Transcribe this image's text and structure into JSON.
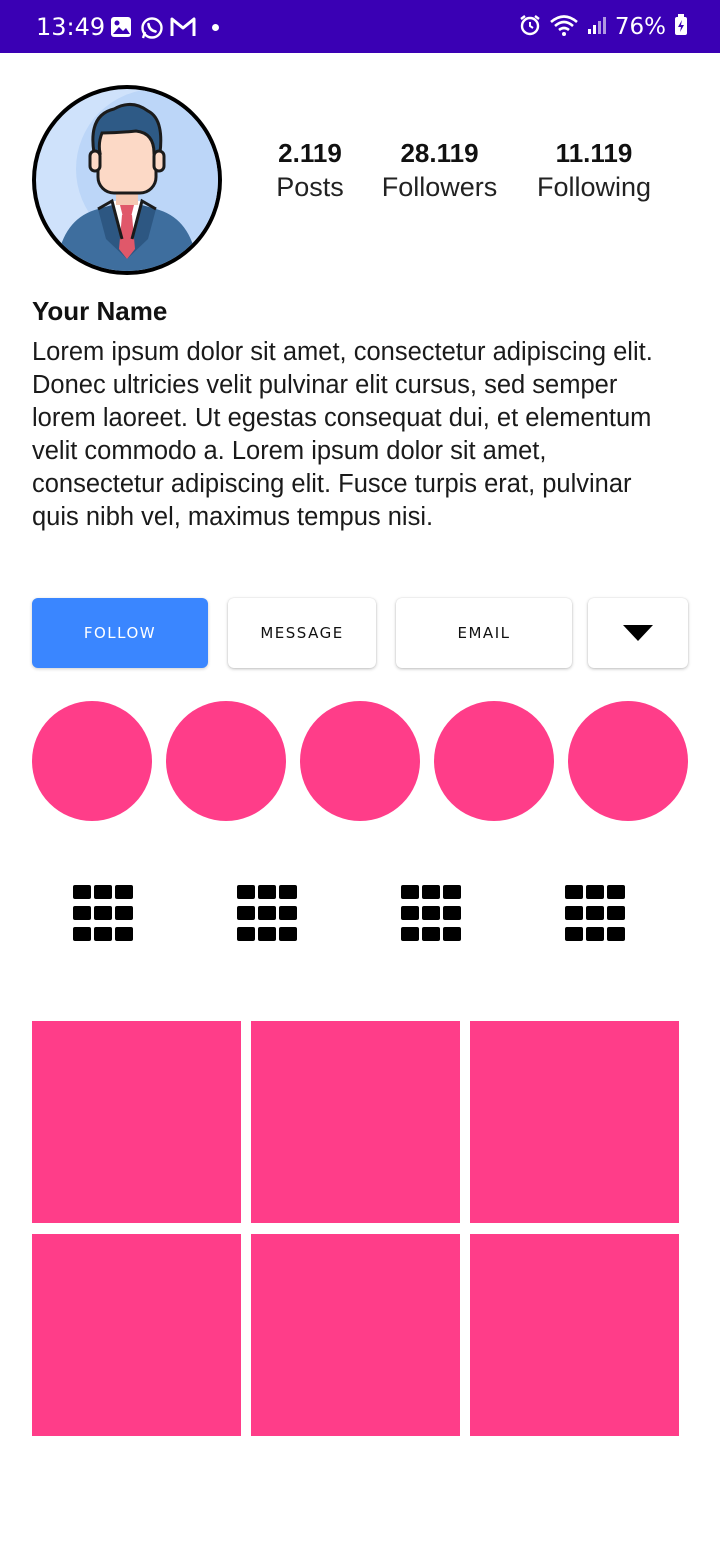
{
  "status_bar": {
    "time": "13:49",
    "left_icons": [
      "gallery-icon",
      "whatsapp-icon",
      "gmail-icon"
    ],
    "right_icons": [
      "alarm-icon",
      "wifi-icon",
      "signal-icon"
    ],
    "battery": "76%"
  },
  "profile": {
    "avatar": "avatar-icon",
    "name": "Your Name",
    "bio": "Lorem ipsum dolor sit amet, consectetur adipiscing elit. Donec ultricies velit pulvinar elit cursus, sed semper lorem laoreet. Ut egestas consequat dui, et elementum velit commodo a. Lorem ipsum dolor sit amet, consectetur adipiscing elit. Fusce turpis erat, pulvinar quis nibh vel, maximus tempus nisi."
  },
  "stats": [
    {
      "value": "2.119",
      "label": "Posts"
    },
    {
      "value": "28.119",
      "label": "Followers"
    },
    {
      "value": "11.119",
      "label": "Following"
    }
  ],
  "actions": {
    "follow": "FOLLOW",
    "message": "MESSAGE",
    "email": "EMAIL",
    "more_icon": "caret-down-icon"
  },
  "highlights_count": 5,
  "tabs": [
    "grid-icon",
    "grid-icon",
    "grid-icon",
    "grid-icon"
  ],
  "posts_count": 6,
  "colors": {
    "status_bar": "#3a00b4",
    "accent": "#3a86ff",
    "pink": "#ff3d89"
  }
}
